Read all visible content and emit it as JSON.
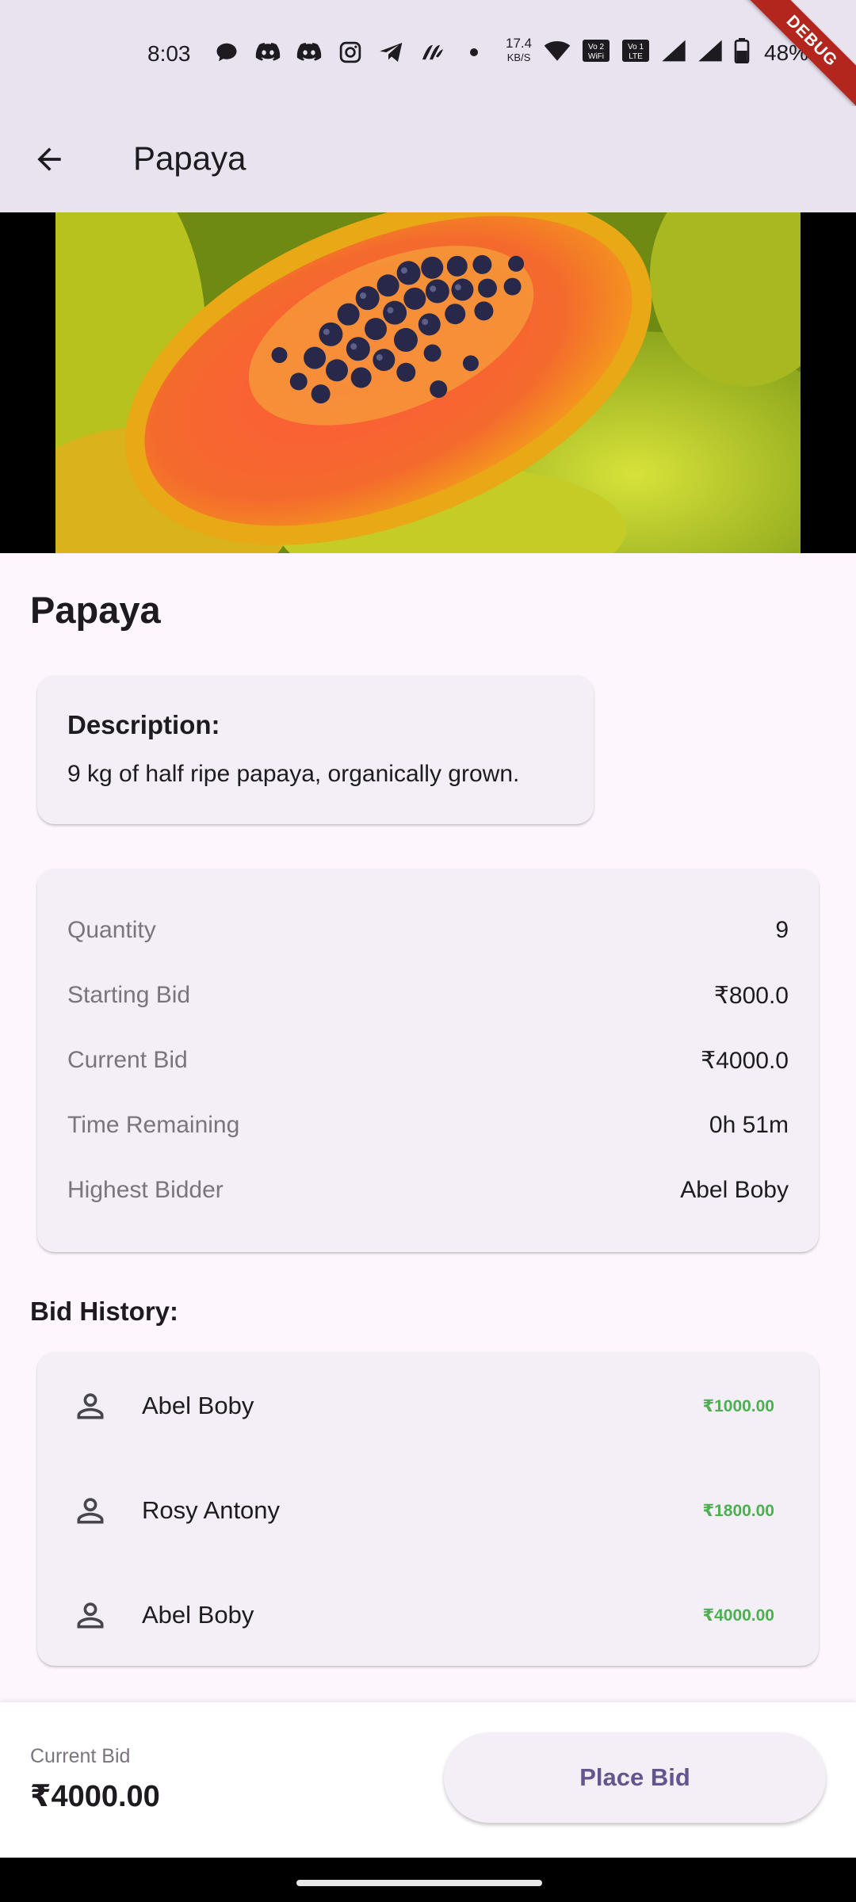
{
  "status_bar": {
    "time": "8:03",
    "net_speed_value": "17.4",
    "net_speed_unit": "KB/S",
    "battery": "48%",
    "icons": [
      "chat-bubble-icon",
      "discord-icon",
      "discord-icon",
      "instagram-icon",
      "telegram-icon",
      "app-icon",
      "dot-icon",
      "wifi-icon",
      "vowifi-icon",
      "volte-icon",
      "signal-icon",
      "signal-icon",
      "battery-icon"
    ],
    "vowifi_label": "Vo 2 WiFi",
    "volte_label": "Vo 1 LTE"
  },
  "debug_banner": "DEBUG",
  "app_bar": {
    "title": "Papaya",
    "back_icon": "arrow-back-icon"
  },
  "product": {
    "name": "Papaya",
    "image_subject": "papaya"
  },
  "description": {
    "title": "Description:",
    "text": "9 kg of half ripe papaya, organically grown."
  },
  "details": [
    {
      "label": "Quantity",
      "value": "9"
    },
    {
      "label": "Starting Bid",
      "value": "₹800.0"
    },
    {
      "label": "Current Bid",
      "value": "₹4000.0"
    },
    {
      "label": "Time Remaining",
      "value": "0h 51m"
    },
    {
      "label": "Highest Bidder",
      "value": "Abel Boby"
    }
  ],
  "bid_history": {
    "title": "Bid History:",
    "items": [
      {
        "name": "Abel Boby",
        "amount": "₹1000.00",
        "icon": "person-outline-icon"
      },
      {
        "name": "Rosy Antony",
        "amount": "₹1800.00",
        "icon": "person-outline-icon"
      },
      {
        "name": "Abel Boby",
        "amount": "₹4000.00",
        "icon": "person-outline-icon"
      }
    ]
  },
  "bottom_bar": {
    "current_bid_label": "Current Bid",
    "current_bid_value": "₹4000.00",
    "place_bid_label": "Place Bid"
  },
  "colors": {
    "app_bar_bg": "#e9e3ef",
    "page_bg": "#fdf7fd",
    "card_bg": "#f4eff6",
    "amount_green": "#4caf50",
    "button_text": "#65558f",
    "debug_red": "#b3261e"
  }
}
